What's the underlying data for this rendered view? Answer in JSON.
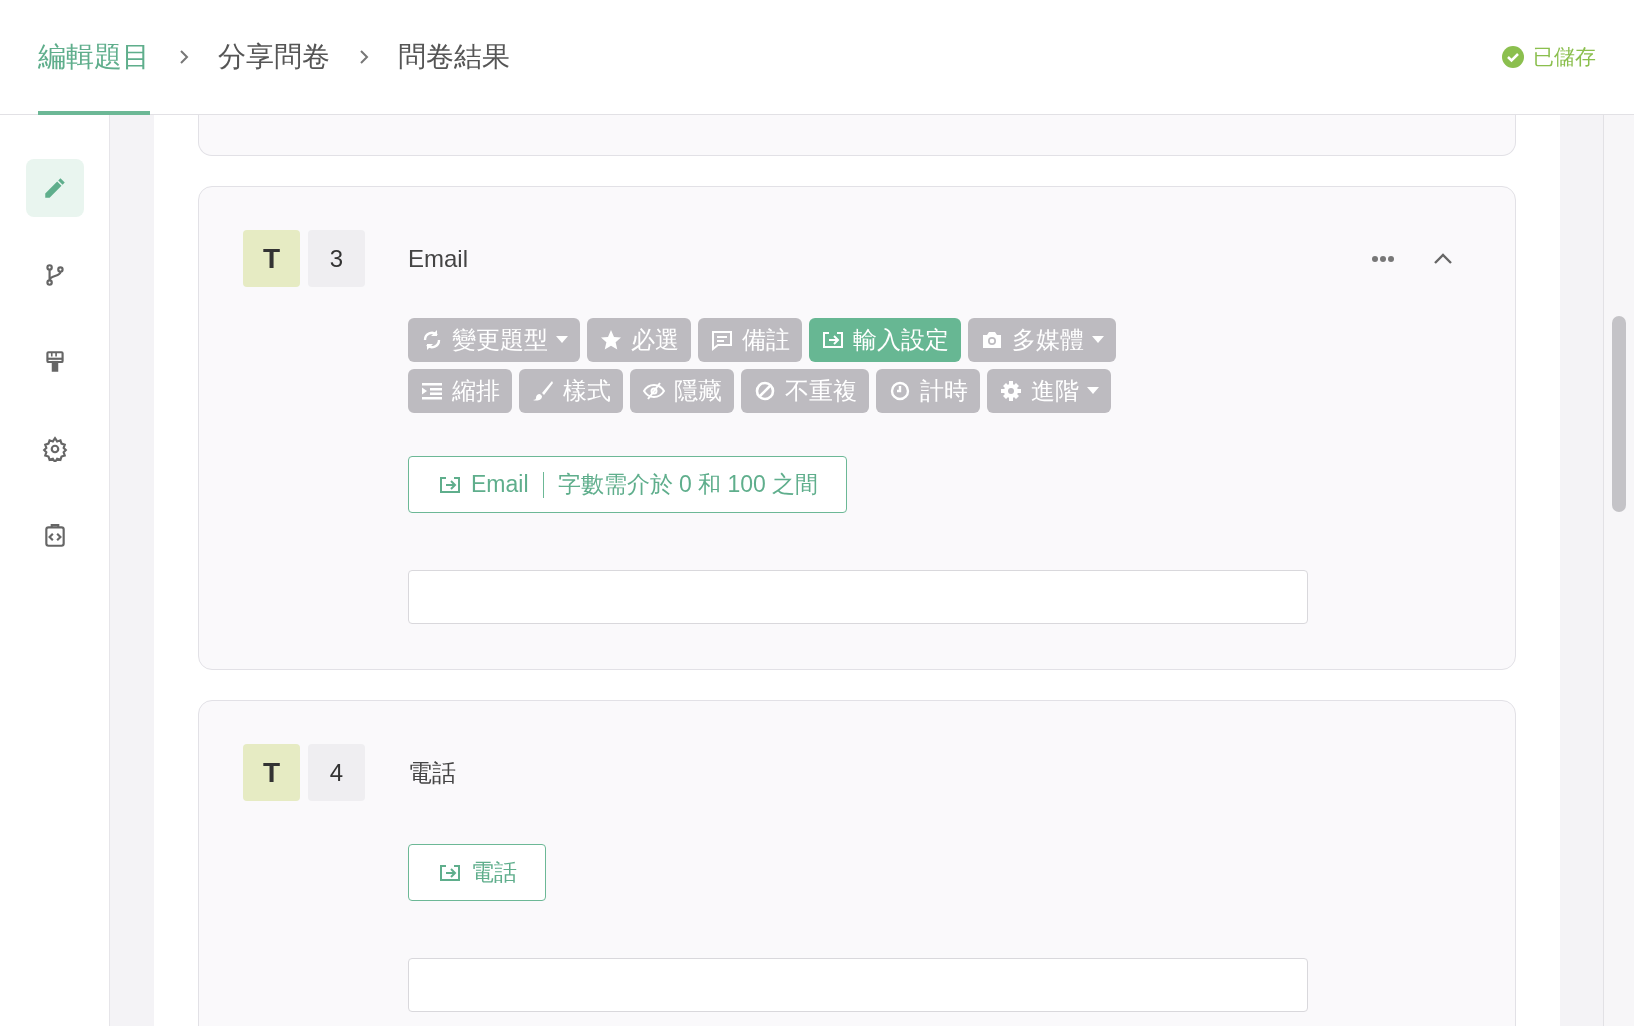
{
  "breadcrumb": [
    {
      "label": "編輯題目",
      "selected": true
    },
    {
      "label": "分享問卷",
      "selected": false
    },
    {
      "label": "問卷結果",
      "selected": false
    }
  ],
  "save_status": "已儲存",
  "sidebar": {
    "items": [
      {
        "selected": true
      },
      {
        "selected": false
      },
      {
        "selected": false
      },
      {
        "selected": false
      },
      {
        "selected": false
      }
    ]
  },
  "questions": [
    {
      "kind": "partial"
    },
    {
      "kind": "question",
      "type_badge": "T",
      "number": "3",
      "title": "Email",
      "expanded": true,
      "toolbar": [
        {
          "label": "變更題型",
          "dropdown": true,
          "selected": false
        },
        {
          "label": "必選",
          "dropdown": false,
          "selected": false
        },
        {
          "label": "備註",
          "dropdown": false,
          "selected": false
        },
        {
          "label": "輸入設定",
          "dropdown": false,
          "selected": true
        },
        {
          "label": "多媒體",
          "dropdown": true,
          "selected": false
        },
        {
          "label": "縮排",
          "dropdown": false,
          "selected": false
        },
        {
          "label": "樣式",
          "dropdown": false,
          "selected": false
        },
        {
          "label": "隱藏",
          "dropdown": false,
          "selected": false
        },
        {
          "label": "不重複",
          "dropdown": false,
          "selected": false
        },
        {
          "label": "計時",
          "dropdown": false,
          "selected": false
        },
        {
          "label": "進階",
          "dropdown": true,
          "selected": false
        }
      ],
      "input_setting": {
        "label": "Email",
        "detail": "字數需介於 0 和 100 之間"
      }
    },
    {
      "kind": "question",
      "type_badge": "T",
      "number": "4",
      "title": "電話",
      "expanded": false,
      "input_setting": {
        "label": "電話"
      }
    }
  ]
}
